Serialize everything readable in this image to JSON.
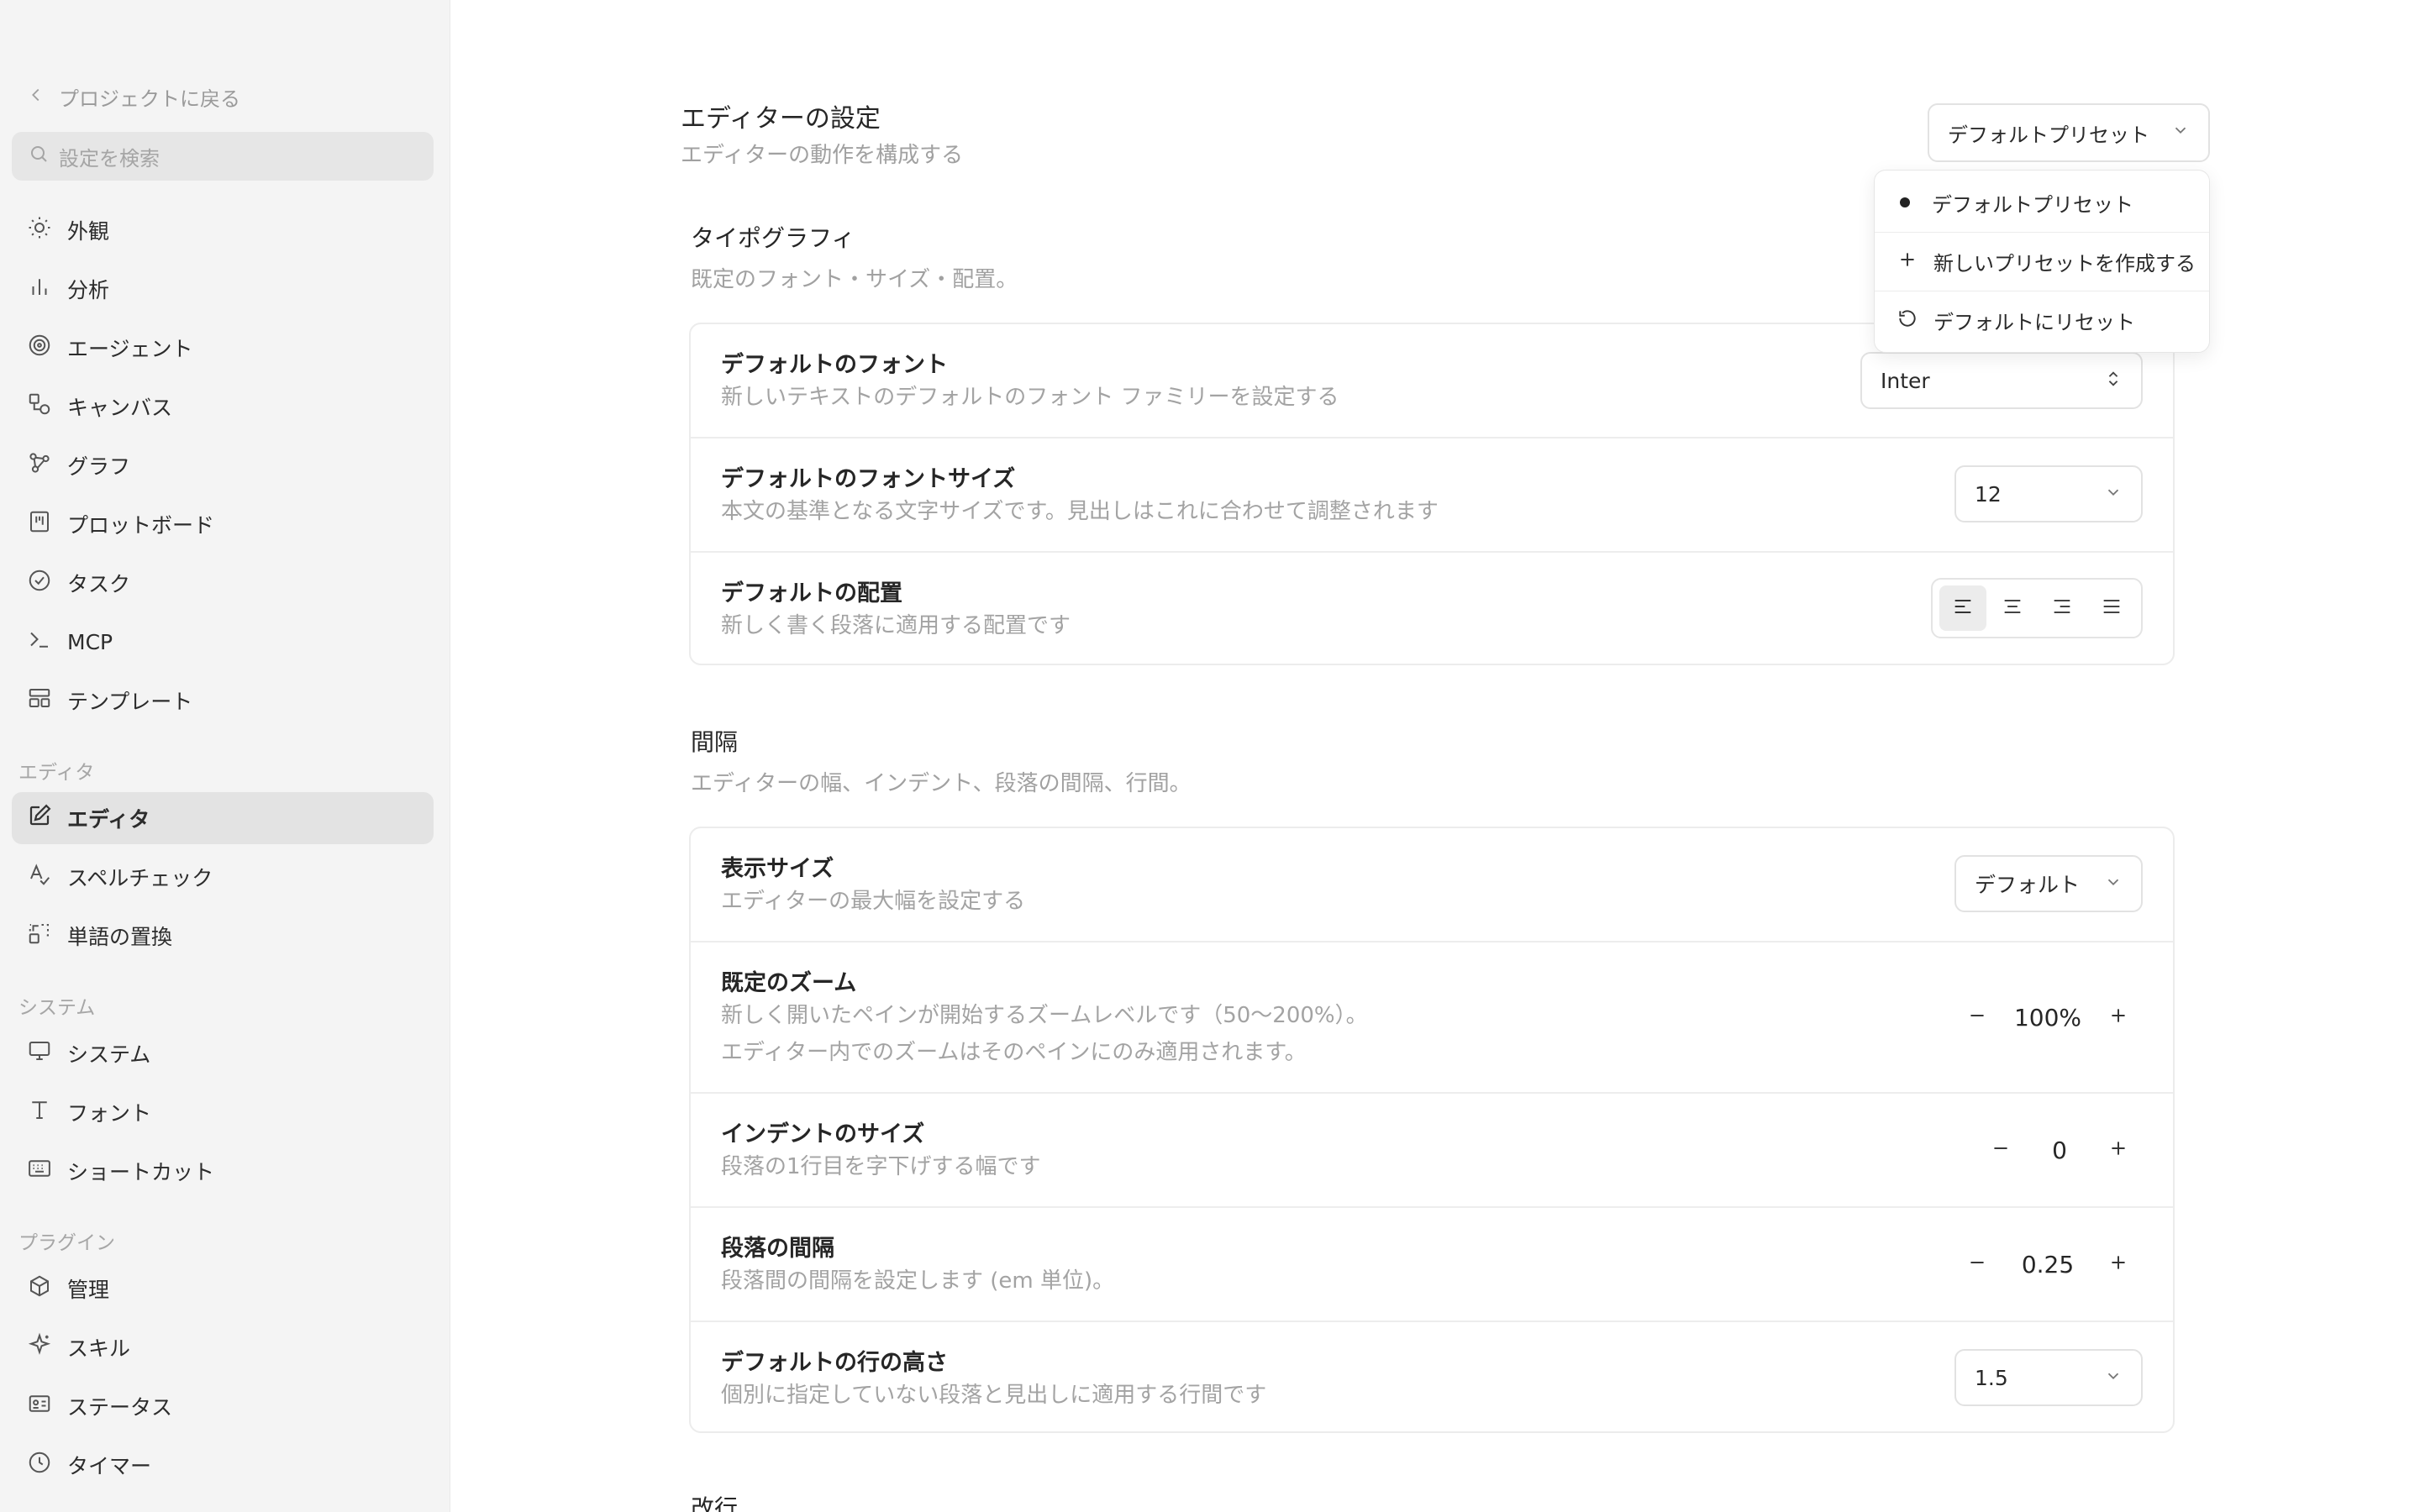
{
  "sidebar": {
    "back_label": "プロジェクトに戻る",
    "search_placeholder": "設定を検索",
    "items_main": [
      {
        "label": "外観",
        "icon": "sun-icon"
      },
      {
        "label": "分析",
        "icon": "bar-chart-icon"
      },
      {
        "label": "エージェント",
        "icon": "spiral-icon"
      },
      {
        "label": "キャンバス",
        "icon": "shapes-icon"
      },
      {
        "label": "グラフ",
        "icon": "graph-icon"
      },
      {
        "label": "プロットボード",
        "icon": "board-icon"
      },
      {
        "label": "タスク",
        "icon": "check-circle-icon"
      },
      {
        "label": "MCP",
        "icon": "terminal-icon"
      },
      {
        "label": "テンプレート",
        "icon": "layout-icon"
      }
    ],
    "section_editor": "エディタ",
    "items_editor": [
      {
        "label": "エディタ",
        "icon": "edit-icon",
        "active": true
      },
      {
        "label": "スペルチェック",
        "icon": "spellcheck-icon"
      },
      {
        "label": "単語の置換",
        "icon": "replace-icon"
      }
    ],
    "section_system": "システム",
    "items_system": [
      {
        "label": "システム",
        "icon": "monitor-icon"
      },
      {
        "label": "フォント",
        "icon": "type-icon"
      },
      {
        "label": "ショートカット",
        "icon": "keyboard-icon"
      }
    ],
    "section_plugins": "プラグイン",
    "items_plugins": [
      {
        "label": "管理",
        "icon": "package-icon"
      },
      {
        "label": "スキル",
        "icon": "sparkle-icon"
      },
      {
        "label": "ステータス",
        "icon": "id-card-icon"
      },
      {
        "label": "タイマー",
        "icon": "clock-icon"
      }
    ]
  },
  "header": {
    "title": "エディターの設定",
    "subtitle": "エディターの動作を構成する",
    "preset_value": "デフォルトプリセット"
  },
  "preset_menu": {
    "items": [
      {
        "label": "デフォルトプリセット",
        "icon": "selected-dot"
      },
      {
        "label": "新しいプリセットを作成する",
        "icon": "plus-icon"
      },
      {
        "label": "デフォルトにリセット",
        "icon": "reset-icon"
      }
    ]
  },
  "typography": {
    "title": "タイポグラフィ",
    "subtitle": "既定のフォント・サイズ・配置。",
    "font": {
      "label": "デフォルトのフォント",
      "desc": "新しいテキストのデフォルトのフォント ファミリーを設定する",
      "value": "Inter"
    },
    "font_size": {
      "label": "デフォルトのフォントサイズ",
      "desc": "本文の基準となる文字サイズです。見出しはこれに合わせて調整されます",
      "value": "12"
    },
    "alignment": {
      "label": "デフォルトの配置",
      "desc": "新しく書く段落に適用する配置です",
      "selected": "left",
      "options": [
        "left",
        "center",
        "right",
        "justify"
      ]
    }
  },
  "spacing": {
    "title": "間隔",
    "subtitle": "エディターの幅、インデント、段落の間隔、行間。",
    "display_size": {
      "label": "表示サイズ",
      "desc": "エディターの最大幅を設定する",
      "value": "デフォルト"
    },
    "zoom": {
      "label": "既定のズーム",
      "desc1": "新しく開いたペインが開始するズームレベルです（50〜200%）。",
      "desc2": "エディター内でのズームはそのペインにのみ適用されます。",
      "value": "100%"
    },
    "indent": {
      "label": "インデントのサイズ",
      "desc": "段落の1行目を字下げする幅です",
      "value": "0"
    },
    "paragraph": {
      "label": "段落の間隔",
      "desc": "段落間の間隔を設定します (em 単位)。",
      "value": "0.25"
    },
    "line_height": {
      "label": "デフォルトの行の高さ",
      "desc": "個別に指定していない段落と見出しに適用する行間です",
      "value": "1.5"
    }
  },
  "line_break": {
    "title": "改行"
  }
}
